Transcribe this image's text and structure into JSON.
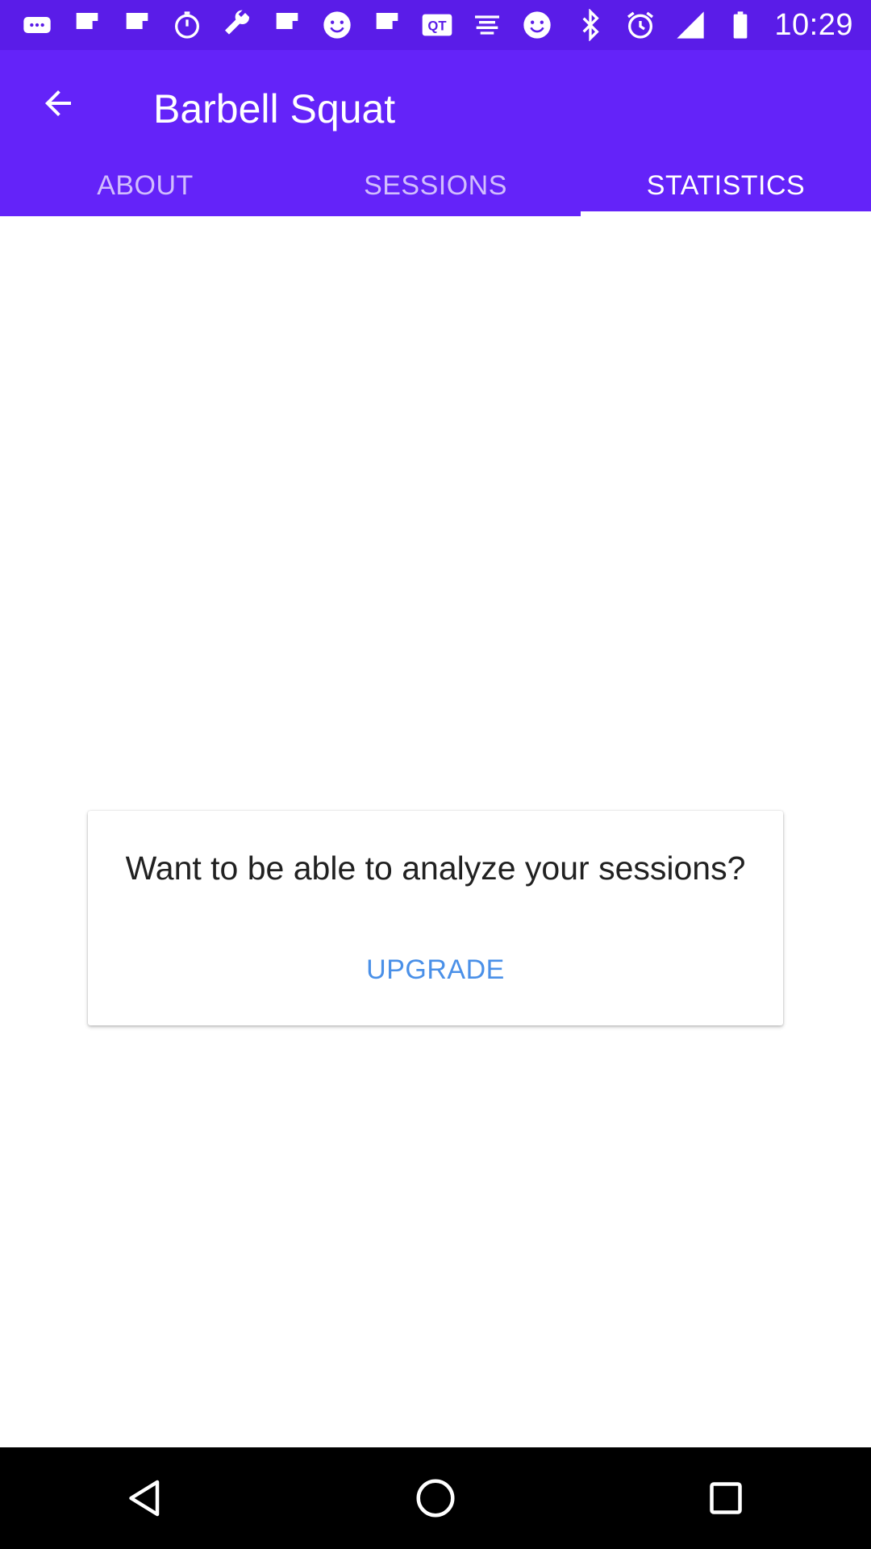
{
  "status_bar": {
    "time": "10:29",
    "left_icons": [
      "message-icon",
      "flipboard-icon",
      "flipboard-icon",
      "stopwatch-icon",
      "wrench-icon",
      "flipboard-icon",
      "smiley-icon",
      "flipboard-icon",
      "qt-icon",
      "app-icon",
      "smiley-icon"
    ],
    "right_icons": [
      "bluetooth-icon",
      "alarm-icon",
      "signal-icon",
      "battery-icon"
    ],
    "qt_label": "QT"
  },
  "app_bar": {
    "title": "Barbell Squat",
    "background_color": "#6423f9",
    "tabs": [
      {
        "label": "ABOUT",
        "active": false
      },
      {
        "label": "SESSIONS",
        "active": false
      },
      {
        "label": "STATISTICS",
        "active": true
      }
    ]
  },
  "card": {
    "message": "Want to be able to analyze your sessions?",
    "button_label": "UPGRADE",
    "button_color": "#4a90e8"
  },
  "nav_bar": {
    "buttons": [
      "back-icon",
      "home-icon",
      "recents-icon"
    ]
  }
}
